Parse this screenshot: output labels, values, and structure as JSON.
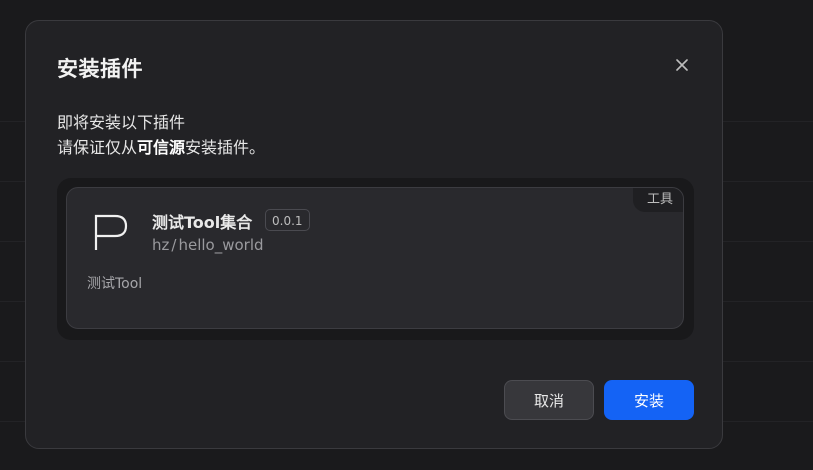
{
  "dialog": {
    "title": "安装插件",
    "close_icon": "close-icon",
    "intro_line1": "即将安装以下插件",
    "intro_line2_prefix": "请保证仅从",
    "intro_line2_bold": "可信源",
    "intro_line2_suffix": "安装插件。"
  },
  "plugin": {
    "logo_icon": "p-letter-logo-icon",
    "name": "测试Tool集合",
    "version": "0.0.1",
    "id_author": "hz",
    "id_separator": "/",
    "id_name": "hello_world",
    "description": "测试Tool",
    "category_tag": "工具"
  },
  "actions": {
    "cancel_label": "取消",
    "install_label": "安装"
  },
  "colors": {
    "primary": "#1463f5",
    "modal_bg": "#222225",
    "card_bg": "#29292d"
  }
}
